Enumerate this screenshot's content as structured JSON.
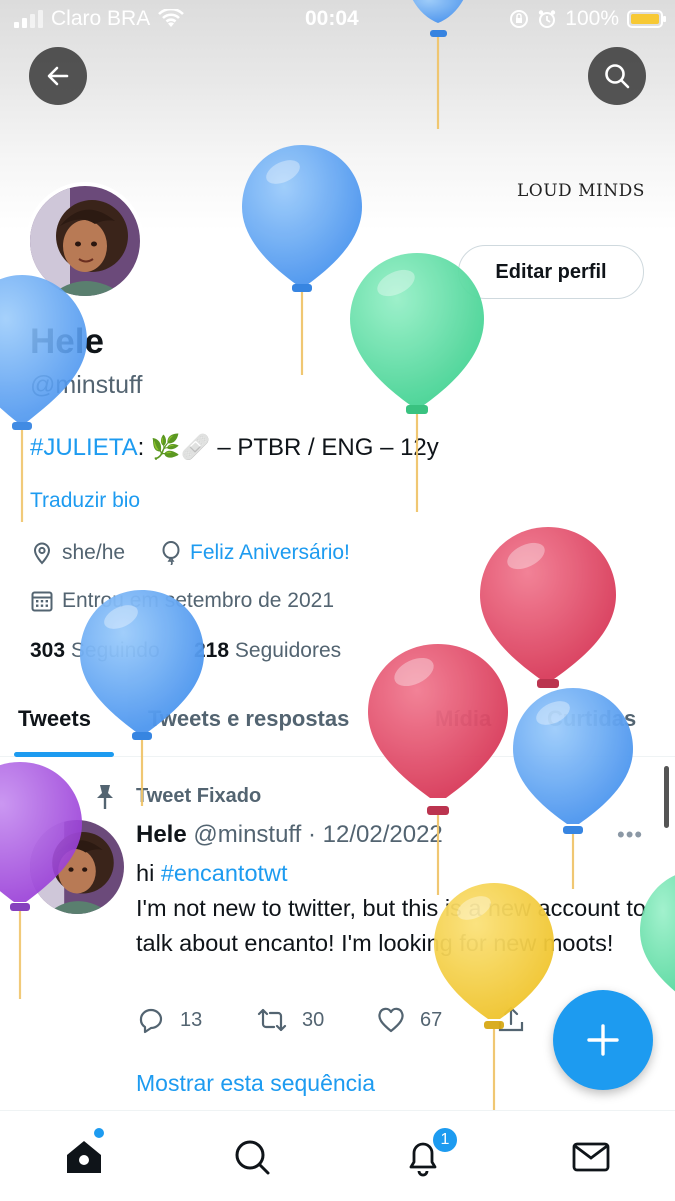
{
  "status_bar": {
    "carrier": "Claro BRA",
    "time": "00:04",
    "battery": "100%"
  },
  "header": {
    "brand_text": "LOUD MINDS"
  },
  "profile": {
    "edit_button": "Editar perfil",
    "name": "Hele",
    "handle": "@minstuff",
    "bio_hashtag": "#JULIETA",
    "bio_rest": ": 🌿🩹 – PTBR / ENG – 12y",
    "translate_bio": "Traduzir bio",
    "pronouns": "she/he",
    "birthday": "Feliz Aniversário!",
    "joined": "Entrou em setembro de 2021",
    "following_count": "303",
    "following_label": "Seguindo",
    "followers_count": "218",
    "followers_label": "Seguidores"
  },
  "tabs": [
    {
      "label": "Tweets"
    },
    {
      "label": "Tweets e respostas"
    },
    {
      "label": "Mídia"
    },
    {
      "label": "Curtidas"
    }
  ],
  "tweet": {
    "pinned_label": "Tweet Fixado",
    "author_name": "Hele",
    "author_handle": "@minstuff",
    "date": "· 12/02/2022",
    "text_line1": "hi ",
    "hashtag": "#encantotwt",
    "text_body": "I'm not new to twitter, but this is a new account to talk about encanto! I'm looking for new moots!",
    "replies": "13",
    "retweets": "30",
    "likes": "67",
    "show_thread": "Mostrar esta sequência"
  },
  "notifications_badge": "1",
  "colors": {
    "accent": "#1d9bf0",
    "balloon_blue": "#5aa8f5",
    "balloon_green": "#5fe0a4",
    "balloon_red": "#e24a66",
    "balloon_purple": "#a64de0",
    "balloon_yellow": "#f5d040"
  }
}
